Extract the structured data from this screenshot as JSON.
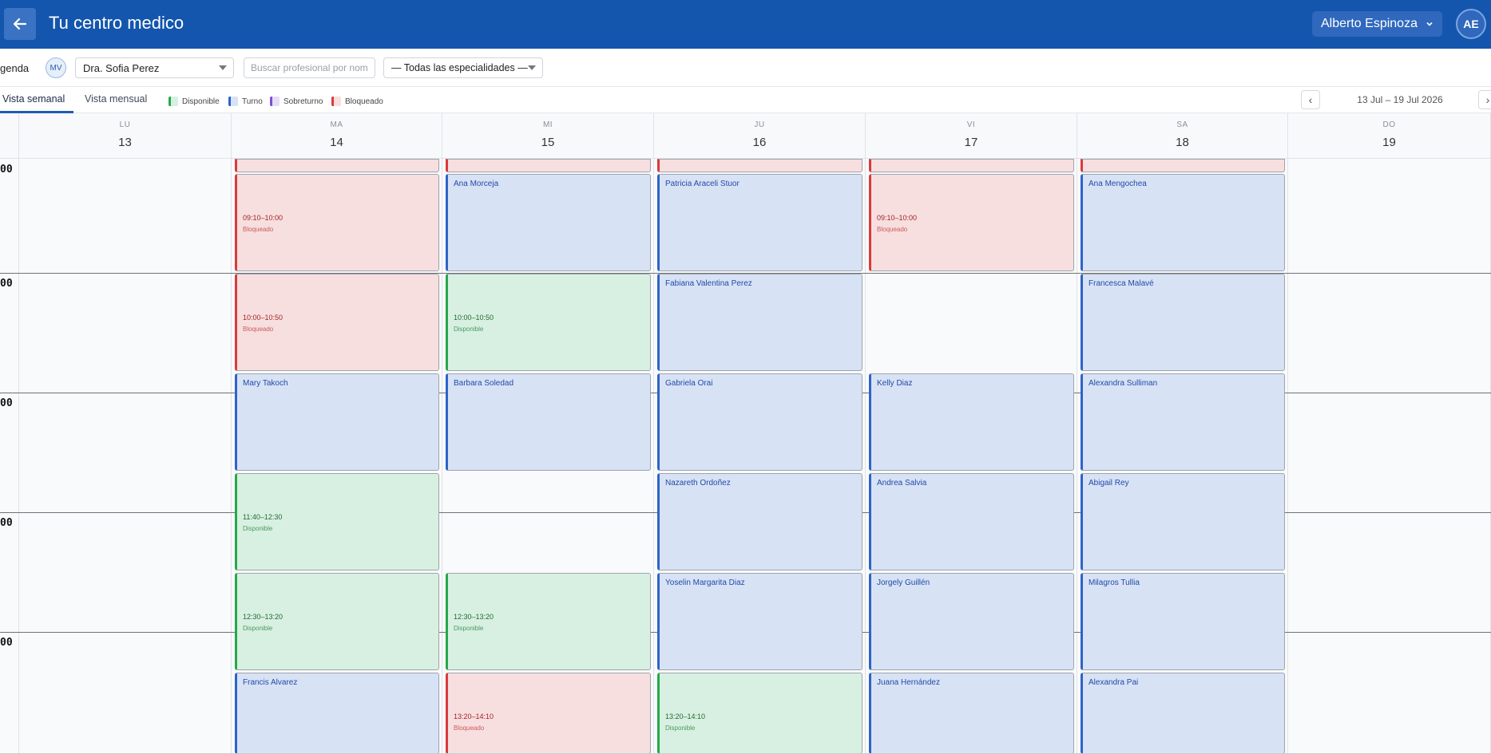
{
  "header": {
    "title": "Tu centro medico",
    "user_name": "Alberto Espinoza",
    "avatar_initials": "AE",
    "bg_color": "#1456ad"
  },
  "toolbar": {
    "agenda_label": "genda",
    "pro_initials": "MV",
    "professional": "Dra. Sofia Perez",
    "search_placeholder": "Buscar profesional por nombre",
    "specialty": "— Todas las especialidades —"
  },
  "tabs": {
    "week": "Vista semanal",
    "month": "Vista mensual"
  },
  "legend": [
    {
      "label": "Disponible",
      "color": "#27a84a"
    },
    {
      "label": "Turno",
      "color": "#2e63c9"
    },
    {
      "label": "Sobreturno",
      "color": "#7b4fd6"
    },
    {
      "label": "Bloqueado",
      "color": "#db3a3a"
    }
  ],
  "nav": {
    "prev": "‹",
    "next": "›",
    "range": "13 Jul – 19 Jul 2026"
  },
  "days": [
    {
      "name": "LU",
      "num": "13"
    },
    {
      "name": "MA",
      "num": "14"
    },
    {
      "name": "MI",
      "num": "15"
    },
    {
      "name": "JU",
      "num": "16"
    },
    {
      "name": "VI",
      "num": "17"
    },
    {
      "name": "SA",
      "num": "18"
    },
    {
      "name": "DO",
      "num": "19"
    }
  ],
  "hour_labels": [
    "00",
    "00",
    "00",
    "00",
    "00"
  ],
  "events": [
    {
      "day": 1,
      "slot": 0,
      "type": "blocked",
      "time": "09:10–10:00",
      "status": "Bloqueado"
    },
    {
      "day": 1,
      "slot": 1,
      "type": "blocked",
      "time": "10:00–10:50",
      "status": "Bloqueado"
    },
    {
      "day": 1,
      "slot": 2,
      "type": "turno",
      "name": "Mary Takoch"
    },
    {
      "day": 1,
      "slot": 3,
      "type": "free",
      "time": "11:40–12:30",
      "status": "Disponible"
    },
    {
      "day": 1,
      "slot": 4,
      "type": "free",
      "time": "12:30–13:20",
      "status": "Disponible"
    },
    {
      "day": 1,
      "slot": 5,
      "type": "turno",
      "name": "Francis Alvarez"
    },
    {
      "day": 2,
      "slot": 0,
      "type": "turno",
      "name": "Ana Morceja"
    },
    {
      "day": 2,
      "slot": 1,
      "type": "free",
      "time": "10:00–10:50",
      "status": "Disponible"
    },
    {
      "day": 2,
      "slot": 2,
      "type": "turno",
      "name": "Barbara Soledad"
    },
    {
      "day": 2,
      "slot": 4,
      "type": "free",
      "time": "12:30–13:20",
      "status": "Disponible"
    },
    {
      "day": 2,
      "slot": 5,
      "type": "blocked",
      "time": "13:20–14:10",
      "status": "Bloqueado"
    },
    {
      "day": 3,
      "slot": 0,
      "type": "turno",
      "name": "Patricia Araceli Stuor"
    },
    {
      "day": 3,
      "slot": 1,
      "type": "turno",
      "name": "Fabiana Valentina Perez"
    },
    {
      "day": 3,
      "slot": 2,
      "type": "turno",
      "name": "Gabriela Orai"
    },
    {
      "day": 3,
      "slot": 3,
      "type": "turno",
      "name": "Nazareth Ordoñez"
    },
    {
      "day": 3,
      "slot": 4,
      "type": "turno",
      "name": "Yoselin Margarita Diaz"
    },
    {
      "day": 3,
      "slot": 5,
      "type": "free",
      "time": "13:20–14:10",
      "status": "Disponible"
    },
    {
      "day": 4,
      "slot": 0,
      "type": "blocked",
      "time": "09:10–10:00",
      "status": "Bloqueado"
    },
    {
      "day": 4,
      "slot": 2,
      "type": "turno",
      "name": "Kelly Diaz"
    },
    {
      "day": 4,
      "slot": 3,
      "type": "turno",
      "name": "Andrea Salvia"
    },
    {
      "day": 4,
      "slot": 4,
      "type": "turno",
      "name": "Jorgely Guillén"
    },
    {
      "day": 4,
      "slot": 5,
      "type": "turno",
      "name": "Juana Hernández"
    },
    {
      "day": 5,
      "slot": 0,
      "type": "turno",
      "name": "Ana Mengochea"
    },
    {
      "day": 5,
      "slot": 1,
      "type": "turno",
      "name": "Francesca Malavé"
    },
    {
      "day": 5,
      "slot": 2,
      "type": "turno",
      "name": "Alexandra Sulliman"
    },
    {
      "day": 5,
      "slot": 3,
      "type": "turno",
      "name": "Abigail Rey"
    },
    {
      "day": 5,
      "slot": 4,
      "type": "turno",
      "name": "Milagros Tullia"
    },
    {
      "day": 5,
      "slot": 5,
      "type": "turno",
      "name": "Alexandra Pai"
    }
  ],
  "top_partial_days": [
    1,
    2,
    3,
    4,
    5
  ]
}
